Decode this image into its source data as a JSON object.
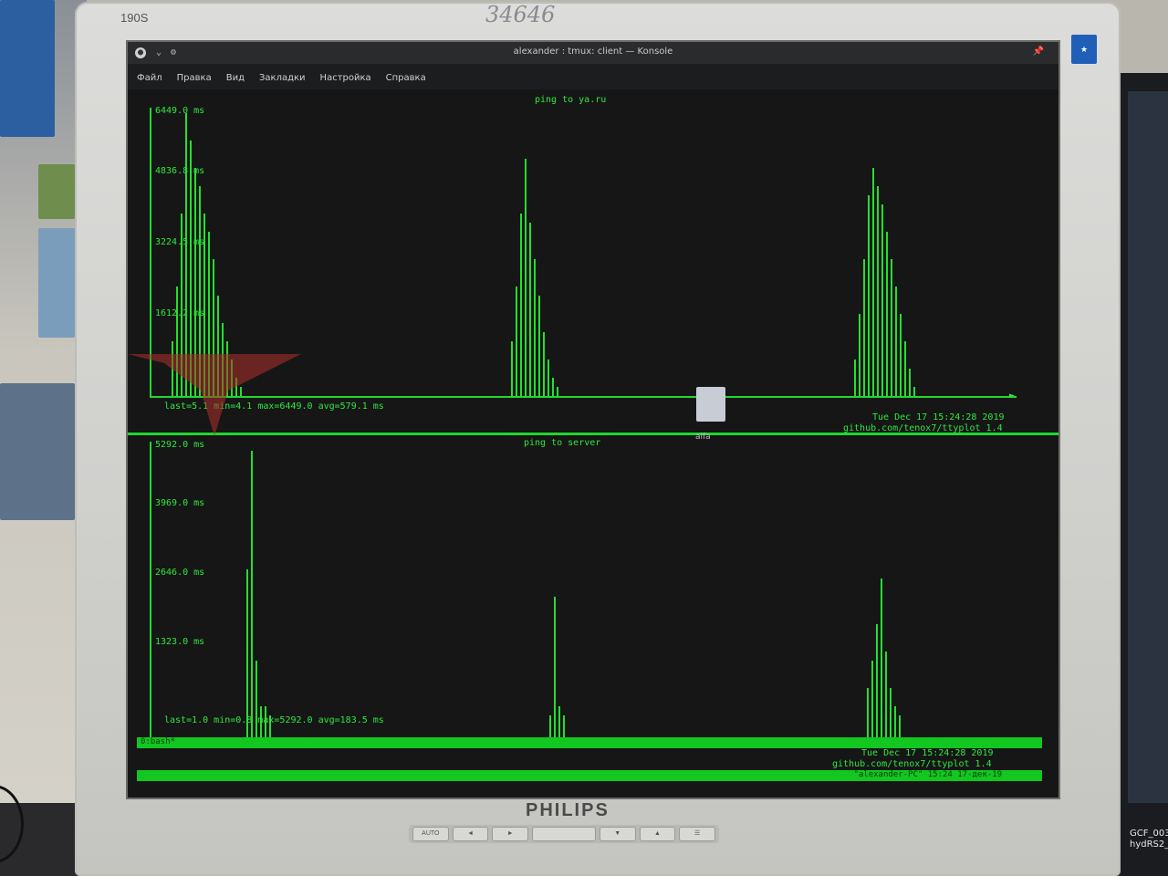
{
  "monitor": {
    "model": "190S",
    "handwritten": "34646",
    "brand": "PHILIPS",
    "buttons": [
      "AUTO",
      "◄",
      "►",
      "",
      "▼",
      "▲",
      "☰"
    ]
  },
  "window": {
    "title": "alexander : tmux: client — Konsole",
    "menu": [
      "Файл",
      "Правка",
      "Вид",
      "Закладки",
      "Настройка",
      "Справка"
    ]
  },
  "pane1": {
    "title": "ping to ya.ru",
    "y_ticks": [
      "6449.0 ms",
      "4836.8 ms",
      "3224.5 ms",
      "1612.2 ms"
    ],
    "stats": "last=5.1 min=4.1 max=6449.0 avg=579.1 ms",
    "date": "Tue Dec 17 15:24:28 2019",
    "credit": "github.com/tenox7/ttyplot 1.4"
  },
  "pane2": {
    "title": "ping to server",
    "y_ticks": [
      "5292.0 ms",
      "3969.0 ms",
      "2646.0 ms",
      "1323.0 ms"
    ],
    "stats": "last=1.0 min=0.8 max=5292.0 avg=183.5 ms",
    "date": "Tue Dec 17 15:24:28 2019",
    "credit": "github.com/tenox7/ttyplot 1.4"
  },
  "tmux": {
    "left": "0:bash*",
    "right": "\"alexander-PC\" 15:24 17-дек-19"
  },
  "desktop": {
    "file_label": "alfa"
  },
  "side_monitor": {
    "line1": "GCF_003",
    "line2": "hydRS2_"
  },
  "colors": {
    "plot_green": "#22e030",
    "screen_bg": "#161616"
  }
}
